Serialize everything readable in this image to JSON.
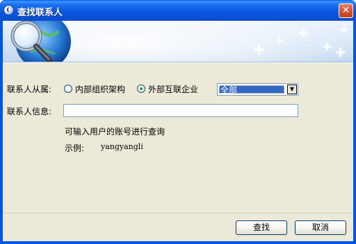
{
  "window": {
    "title": "查找联系人"
  },
  "form": {
    "affiliation_label": "联系人从属:",
    "radio_internal_label": "内部组织架构",
    "radio_external_label": "外部互联企业",
    "radio_selected": "external",
    "enterprise_select": {
      "selected": "全部"
    },
    "info_label": "联系人信息:",
    "info_input": {
      "value": "",
      "placeholder": ""
    },
    "hint": "可输入用户的账号进行查询",
    "example_label": "示例:",
    "example_value": "yangyangli"
  },
  "buttons": {
    "search_label": "查找",
    "cancel_label": "取消"
  }
}
